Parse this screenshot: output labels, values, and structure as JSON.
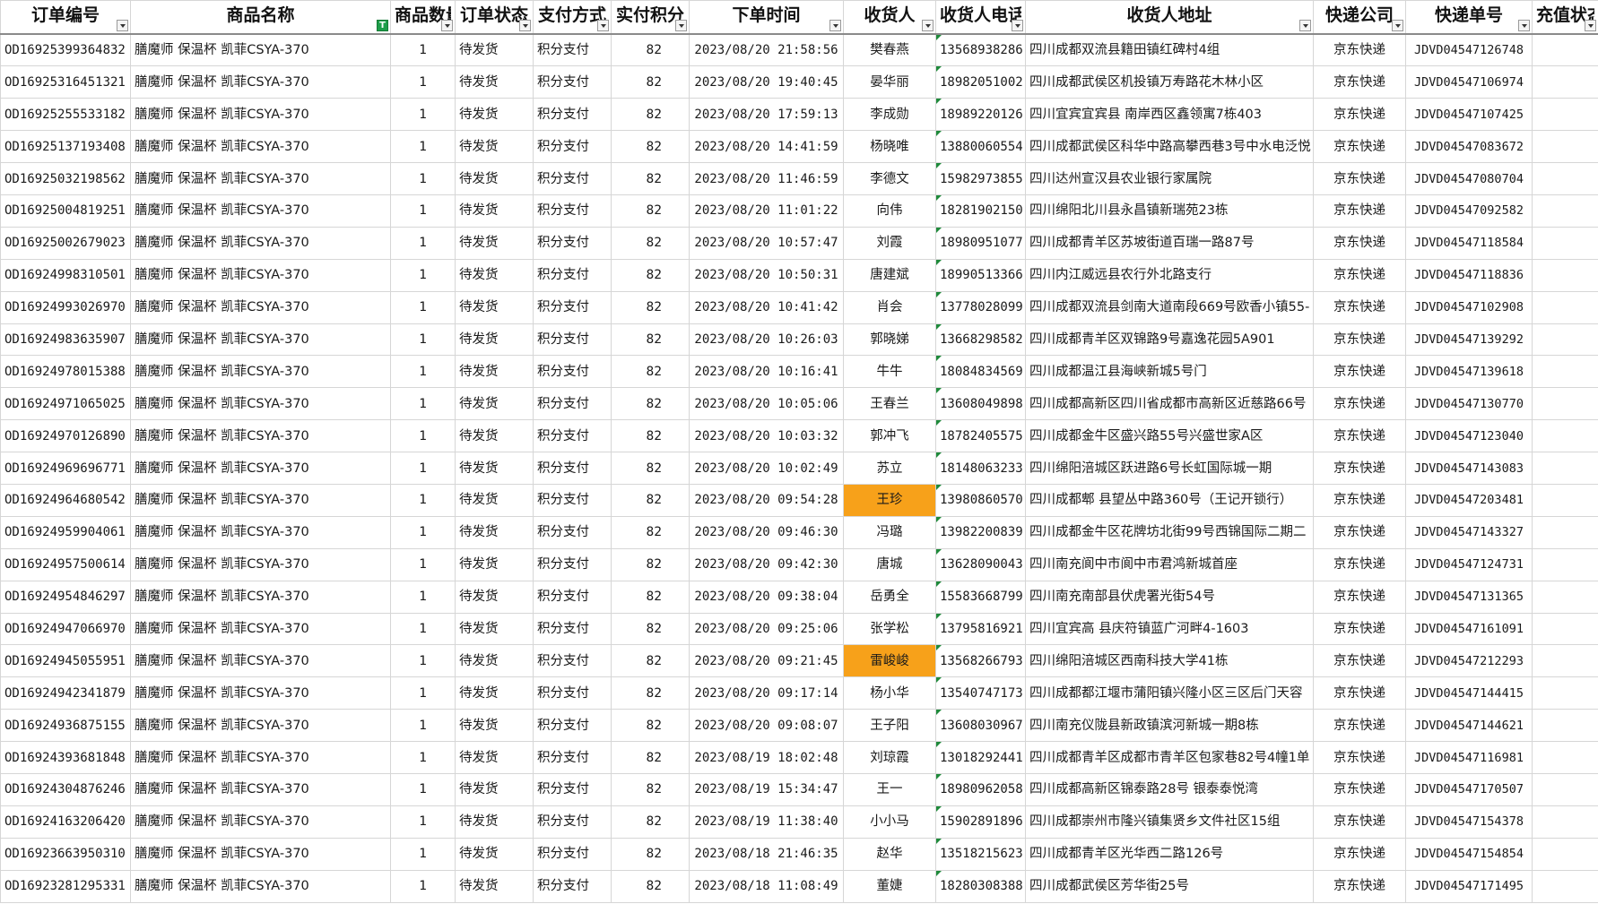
{
  "columns": [
    {
      "key": "id",
      "label": "订单编号",
      "width": 145,
      "filter_active": false
    },
    {
      "key": "product",
      "label": "商品名称",
      "width": 290,
      "filter_active": true
    },
    {
      "key": "qty",
      "label": "商品数量",
      "width": 72,
      "filter_active": false
    },
    {
      "key": "status",
      "label": "订单状态",
      "width": 87,
      "filter_active": false
    },
    {
      "key": "pay",
      "label": "支付方式",
      "width": 87,
      "filter_active": false
    },
    {
      "key": "points",
      "label": "实付积分",
      "width": 87,
      "filter_active": false
    },
    {
      "key": "time",
      "label": "下单时间",
      "width": 172,
      "filter_active": false
    },
    {
      "key": "name",
      "label": "收货人",
      "width": 103,
      "filter_active": false
    },
    {
      "key": "phone",
      "label": "收货人电话",
      "width": 100,
      "filter_active": false
    },
    {
      "key": "address",
      "label": "收货人地址",
      "width": 321,
      "filter_active": false
    },
    {
      "key": "courier",
      "label": "快递公司",
      "width": 103,
      "filter_active": false
    },
    {
      "key": "tracking",
      "label": "快递单号",
      "width": 141,
      "filter_active": false
    },
    {
      "key": "recharge",
      "label": "充值状态",
      "width": 74,
      "filter_active": false
    }
  ],
  "highlight_color": "#f7a11a",
  "rows": [
    {
      "id": "OD16925399364832",
      "product": "膳魔师 保温杯 凯菲CSYA-370",
      "qty": "1",
      "status": "待发货",
      "pay": "积分支付",
      "points": "82",
      "time": "2023/08/20 21:58:56",
      "name": "樊春燕",
      "phone": "13568938286",
      "address": "四川成都双流县籍田镇红碑村4组",
      "courier": "京东快递",
      "tracking": "JDVD04547126748",
      "recharge": "",
      "hl": false
    },
    {
      "id": "OD16925316451321",
      "product": "膳魔师 保温杯 凯菲CSYA-370",
      "qty": "1",
      "status": "待发货",
      "pay": "积分支付",
      "points": "82",
      "time": "2023/08/20 19:40:45",
      "name": "晏华丽",
      "phone": "18982051002",
      "address": "四川成都武侯区机投镇万寿路花木林小区",
      "courier": "京东快递",
      "tracking": "JDVD04547106974",
      "recharge": "",
      "hl": false
    },
    {
      "id": "OD16925255533182",
      "product": "膳魔师 保温杯 凯菲CSYA-370",
      "qty": "1",
      "status": "待发货",
      "pay": "积分支付",
      "points": "82",
      "time": "2023/08/20 17:59:13",
      "name": "李成勋",
      "phone": "18989220126",
      "address": "四川宜宾宜宾县 南岸西区鑫领寓7栋403",
      "courier": "京东快递",
      "tracking": "JDVD04547107425",
      "recharge": "",
      "hl": false
    },
    {
      "id": "OD16925137193408",
      "product": "膳魔师 保温杯 凯菲CSYA-370",
      "qty": "1",
      "status": "待发货",
      "pay": "积分支付",
      "points": "82",
      "time": "2023/08/20 14:41:59",
      "name": "杨晓唯",
      "phone": "13880060554",
      "address": "四川成都武侯区科华中路高攀西巷3号中水电泛悦",
      "courier": "京东快递",
      "tracking": "JDVD04547083672",
      "recharge": "",
      "hl": false
    },
    {
      "id": "OD16925032198562",
      "product": "膳魔师 保温杯 凯菲CSYA-370",
      "qty": "1",
      "status": "待发货",
      "pay": "积分支付",
      "points": "82",
      "time": "2023/08/20 11:46:59",
      "name": "李德文",
      "phone": "15982973855",
      "address": "四川达州宣汉县农业银行家属院",
      "courier": "京东快递",
      "tracking": "JDVD04547080704",
      "recharge": "",
      "hl": false
    },
    {
      "id": "OD16925004819251",
      "product": "膳魔师 保温杯 凯菲CSYA-370",
      "qty": "1",
      "status": "待发货",
      "pay": "积分支付",
      "points": "82",
      "time": "2023/08/20 11:01:22",
      "name": "向伟",
      "phone": "18281902150",
      "address": "四川绵阳北川县永昌镇新瑞苑23栋",
      "courier": "京东快递",
      "tracking": "JDVD04547092582",
      "recharge": "",
      "hl": false
    },
    {
      "id": "OD16925002679023",
      "product": "膳魔师 保温杯 凯菲CSYA-370",
      "qty": "1",
      "status": "待发货",
      "pay": "积分支付",
      "points": "82",
      "time": "2023/08/20 10:57:47",
      "name": "刘霞",
      "phone": "18980951077",
      "address": "四川成都青羊区苏坡街道百瑞一路87号",
      "courier": "京东快递",
      "tracking": "JDVD04547118584",
      "recharge": "",
      "hl": false
    },
    {
      "id": "OD16924998310501",
      "product": "膳魔师 保温杯 凯菲CSYA-370",
      "qty": "1",
      "status": "待发货",
      "pay": "积分支付",
      "points": "82",
      "time": "2023/08/20 10:50:31",
      "name": "唐建斌",
      "phone": "18990513366",
      "address": "四川内江威远县农行外北路支行",
      "courier": "京东快递",
      "tracking": "JDVD04547118836",
      "recharge": "",
      "hl": false
    },
    {
      "id": "OD16924993026970",
      "product": "膳魔师 保温杯 凯菲CSYA-370",
      "qty": "1",
      "status": "待发货",
      "pay": "积分支付",
      "points": "82",
      "time": "2023/08/20 10:41:42",
      "name": "肖会",
      "phone": "13778028099",
      "address": "四川成都双流县剑南大道南段669号欧香小镇55-",
      "courier": "京东快递",
      "tracking": "JDVD04547102908",
      "recharge": "",
      "hl": false
    },
    {
      "id": "OD16924983635907",
      "product": "膳魔师 保温杯 凯菲CSYA-370",
      "qty": "1",
      "status": "待发货",
      "pay": "积分支付",
      "points": "82",
      "time": "2023/08/20 10:26:03",
      "name": "郭晓娣",
      "phone": "13668298582",
      "address": "四川成都青羊区双锦路9号嘉逸花园5A901",
      "courier": "京东快递",
      "tracking": "JDVD04547139292",
      "recharge": "",
      "hl": false
    },
    {
      "id": "OD16924978015388",
      "product": "膳魔师 保温杯 凯菲CSYA-370",
      "qty": "1",
      "status": "待发货",
      "pay": "积分支付",
      "points": "82",
      "time": "2023/08/20 10:16:41",
      "name": "牛牛",
      "phone": "18084834569",
      "address": "四川成都温江县海峡新城5号门",
      "courier": "京东快递",
      "tracking": "JDVD04547139618",
      "recharge": "",
      "hl": false
    },
    {
      "id": "OD16924971065025",
      "product": "膳魔师 保温杯 凯菲CSYA-370",
      "qty": "1",
      "status": "待发货",
      "pay": "积分支付",
      "points": "82",
      "time": "2023/08/20 10:05:06",
      "name": "王春兰",
      "phone": "13608049898",
      "address": "四川成都高新区四川省成都市高新区近慈路66号",
      "courier": "京东快递",
      "tracking": "JDVD04547130770",
      "recharge": "",
      "hl": false
    },
    {
      "id": "OD16924970126890",
      "product": "膳魔师 保温杯 凯菲CSYA-370",
      "qty": "1",
      "status": "待发货",
      "pay": "积分支付",
      "points": "82",
      "time": "2023/08/20 10:03:32",
      "name": "郭冲飞",
      "phone": "18782405575",
      "address": "四川成都金牛区盛兴路55号兴盛世家A区",
      "courier": "京东快递",
      "tracking": "JDVD04547123040",
      "recharge": "",
      "hl": false
    },
    {
      "id": "OD16924969696771",
      "product": "膳魔师 保温杯 凯菲CSYA-370",
      "qty": "1",
      "status": "待发货",
      "pay": "积分支付",
      "points": "82",
      "time": "2023/08/20 10:02:49",
      "name": "苏立",
      "phone": "18148063233",
      "address": "四川绵阳涪城区跃进路6号长虹国际城一期",
      "courier": "京东快递",
      "tracking": "JDVD04547143083",
      "recharge": "",
      "hl": false
    },
    {
      "id": "OD16924964680542",
      "product": "膳魔师 保温杯 凯菲CSYA-370",
      "qty": "1",
      "status": "待发货",
      "pay": "积分支付",
      "points": "82",
      "time": "2023/08/20 09:54:28",
      "name": "王珍",
      "phone": "13980860570",
      "address": "四川成都郫 县望丛中路360号（王记开锁行）",
      "courier": "京东快递",
      "tracking": "JDVD04547203481",
      "recharge": "",
      "hl": true
    },
    {
      "id": "OD16924959904061",
      "product": "膳魔师 保温杯 凯菲CSYA-370",
      "qty": "1",
      "status": "待发货",
      "pay": "积分支付",
      "points": "82",
      "time": "2023/08/20 09:46:30",
      "name": "冯璐",
      "phone": "13982200839",
      "address": "四川成都金牛区花牌坊北街99号西锦国际二期二",
      "courier": "京东快递",
      "tracking": "JDVD04547143327",
      "recharge": "",
      "hl": false
    },
    {
      "id": "OD16924957500614",
      "product": "膳魔师 保温杯 凯菲CSYA-370",
      "qty": "1",
      "status": "待发货",
      "pay": "积分支付",
      "points": "82",
      "time": "2023/08/20 09:42:30",
      "name": "唐城",
      "phone": "13628090043",
      "address": "四川南充阆中市阆中市君鸿新城首座",
      "courier": "京东快递",
      "tracking": "JDVD04547124731",
      "recharge": "",
      "hl": false
    },
    {
      "id": "OD16924954846297",
      "product": "膳魔师 保温杯 凯菲CSYA-370",
      "qty": "1",
      "status": "待发货",
      "pay": "积分支付",
      "points": "82",
      "time": "2023/08/20 09:38:04",
      "name": "岳勇全",
      "phone": "15583668799",
      "address": "四川南充南部县伏虎署光街54号",
      "courier": "京东快递",
      "tracking": "JDVD04547131365",
      "recharge": "",
      "hl": false
    },
    {
      "id": "OD16924947066970",
      "product": "膳魔师 保温杯 凯菲CSYA-370",
      "qty": "1",
      "status": "待发货",
      "pay": "积分支付",
      "points": "82",
      "time": "2023/08/20 09:25:06",
      "name": "张学松",
      "phone": "13795816921",
      "address": "四川宜宾高 县庆符镇蓝广河畔4-1603",
      "courier": "京东快递",
      "tracking": "JDVD04547161091",
      "recharge": "",
      "hl": false
    },
    {
      "id": "OD16924945055951",
      "product": "膳魔师 保温杯 凯菲CSYA-370",
      "qty": "1",
      "status": "待发货",
      "pay": "积分支付",
      "points": "82",
      "time": "2023/08/20 09:21:45",
      "name": "雷峻峻",
      "phone": "13568266793",
      "address": "四川绵阳涪城区西南科技大学41栋",
      "courier": "京东快递",
      "tracking": "JDVD04547212293",
      "recharge": "",
      "hl": true
    },
    {
      "id": "OD16924942341879",
      "product": "膳魔师 保温杯 凯菲CSYA-370",
      "qty": "1",
      "status": "待发货",
      "pay": "积分支付",
      "points": "82",
      "time": "2023/08/20 09:17:14",
      "name": "杨小华",
      "phone": "13540747173",
      "address": "四川成都都江堰市蒲阳镇兴隆小区三区后门天容",
      "courier": "京东快递",
      "tracking": "JDVD04547144415",
      "recharge": "",
      "hl": false
    },
    {
      "id": "OD16924936875155",
      "product": "膳魔师 保温杯 凯菲CSYA-370",
      "qty": "1",
      "status": "待发货",
      "pay": "积分支付",
      "points": "82",
      "time": "2023/08/20 09:08:07",
      "name": "王子阳",
      "phone": "13608030967",
      "address": "四川南充仪陇县新政镇滨河新城一期8栋",
      "courier": "京东快递",
      "tracking": "JDVD04547144621",
      "recharge": "",
      "hl": false
    },
    {
      "id": "OD16924393681848",
      "product": "膳魔师 保温杯 凯菲CSYA-370",
      "qty": "1",
      "status": "待发货",
      "pay": "积分支付",
      "points": "82",
      "time": "2023/08/19 18:02:48",
      "name": "刘琼霞",
      "phone": "13018292441",
      "address": "四川成都青羊区成都市青羊区包家巷82号4幢1单",
      "courier": "京东快递",
      "tracking": "JDVD04547116981",
      "recharge": "",
      "hl": false
    },
    {
      "id": "OD16924304876246",
      "product": "膳魔师 保温杯 凯菲CSYA-370",
      "qty": "1",
      "status": "待发货",
      "pay": "积分支付",
      "points": "82",
      "time": "2023/08/19 15:34:47",
      "name": "王一",
      "phone": "18980962058",
      "address": "四川成都高新区锦泰路28号 银泰泰悦湾",
      "courier": "京东快递",
      "tracking": "JDVD04547170507",
      "recharge": "",
      "hl": false
    },
    {
      "id": "OD16924163206420",
      "product": "膳魔师 保温杯 凯菲CSYA-370",
      "qty": "1",
      "status": "待发货",
      "pay": "积分支付",
      "points": "82",
      "time": "2023/08/19 11:38:40",
      "name": "小小马",
      "phone": "15902891896",
      "address": "四川成都崇州市隆兴镇集贤乡文件社区15组",
      "courier": "京东快递",
      "tracking": "JDVD04547154378",
      "recharge": "",
      "hl": false
    },
    {
      "id": "OD16923663950310",
      "product": "膳魔师 保温杯 凯菲CSYA-370",
      "qty": "1",
      "status": "待发货",
      "pay": "积分支付",
      "points": "82",
      "time": "2023/08/18 21:46:35",
      "name": "赵华",
      "phone": "13518215623",
      "address": "四川成都青羊区光华西二路126号",
      "courier": "京东快递",
      "tracking": "JDVD04547154854",
      "recharge": "",
      "hl": false
    },
    {
      "id": "OD16923281295331",
      "product": "膳魔师 保温杯 凯菲CSYA-370",
      "qty": "1",
      "status": "待发货",
      "pay": "积分支付",
      "points": "82",
      "time": "2023/08/18 11:08:49",
      "name": "董婕",
      "phone": "18280308388",
      "address": "四川成都武侯区芳华街25号",
      "courier": "京东快递",
      "tracking": "JDVD04547171495",
      "recharge": "",
      "hl": false
    }
  ]
}
